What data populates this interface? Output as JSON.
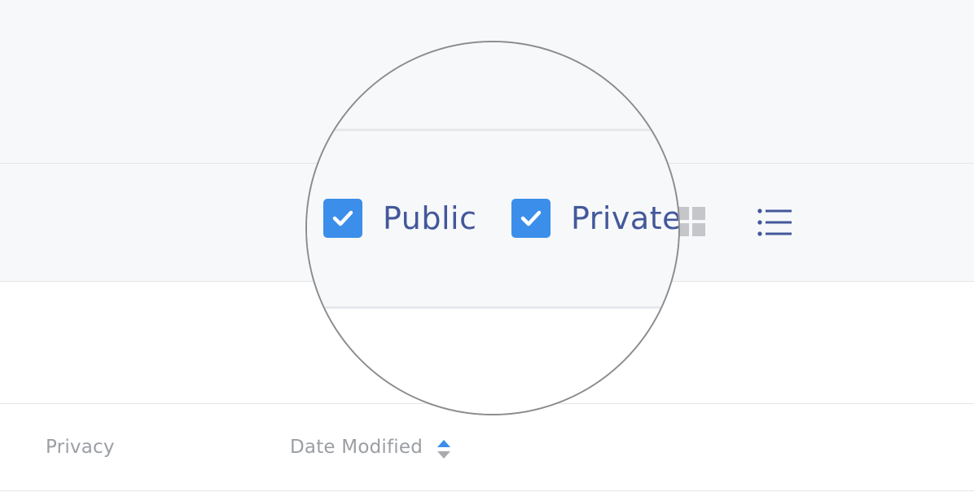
{
  "filters": {
    "public_label": "Public",
    "private_label": "Private",
    "public_checked": true,
    "private_checked": true
  },
  "view_toggle": {
    "grid_icon": "grid-view-icon",
    "list_icon": "list-view-icon"
  },
  "table": {
    "columns": [
      "Privacy",
      "Date Modified"
    ],
    "sort_icon": "sort-arrows-icon"
  },
  "colors": {
    "checkbox": "#3b8eea",
    "label_text": "#43589a",
    "header_text": "#9b9ea3",
    "background": "#f7f8fa"
  }
}
